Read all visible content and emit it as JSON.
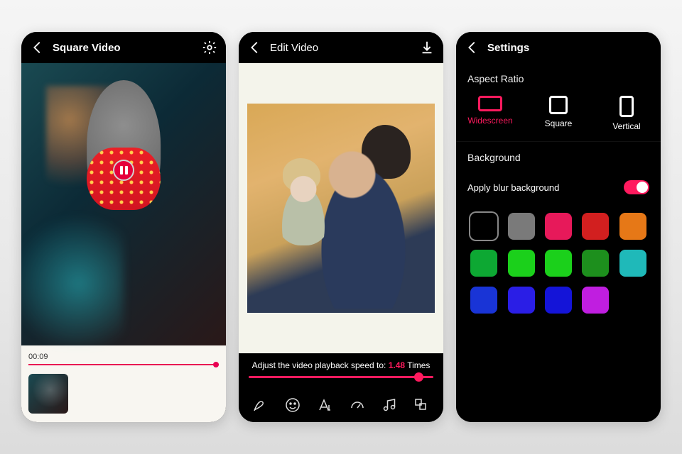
{
  "screen1": {
    "title": "Square Video",
    "timestamp": "00:09"
  },
  "screen2": {
    "title": "Edit Video",
    "speed": {
      "prefix": "Adjust the video playback speed to:",
      "value": "1.48",
      "suffix": "Times"
    },
    "tools": [
      "draw",
      "emoji",
      "text",
      "speed",
      "music",
      "layout"
    ]
  },
  "screen3": {
    "title": "Settings",
    "section_aspect": "Aspect Ratio",
    "ratios": [
      {
        "label": "Widescreen",
        "selected": true
      },
      {
        "label": "Square",
        "selected": false
      },
      {
        "label": "Vertical",
        "selected": false
      }
    ],
    "section_bg": "Background",
    "blur_label": "Apply blur background",
    "blur_on": true,
    "swatches": [
      "#000000",
      "#7a7a7a",
      "#e7195a",
      "#d21f1f",
      "#e67817",
      "#0da833",
      "#1bd01b",
      "#1bd01b",
      "#1d8f1d",
      "#1fb9b9",
      "#1934d6",
      "#2a1ee6",
      "#1414d8",
      "#c01ee0"
    ]
  }
}
